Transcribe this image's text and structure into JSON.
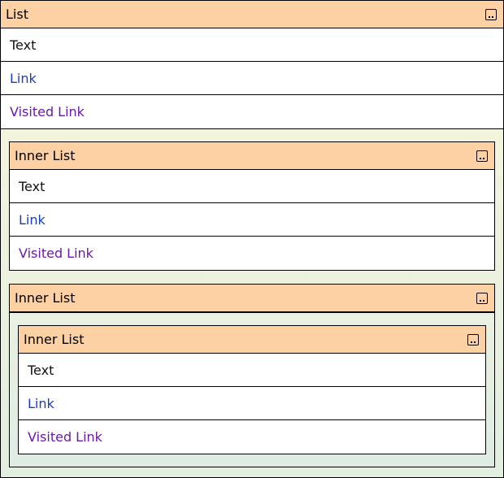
{
  "root": {
    "title": "List",
    "rows": [
      {
        "label": "Text"
      },
      {
        "label": "Link"
      },
      {
        "label": "Visited Link"
      }
    ]
  },
  "inner1": {
    "title": "Inner List",
    "rows": [
      {
        "label": "Text"
      },
      {
        "label": "Link"
      },
      {
        "label": "Visited Link"
      }
    ]
  },
  "inner2": {
    "title": "Inner List"
  },
  "inner3": {
    "title": "Inner List",
    "rows": [
      {
        "label": "Text"
      },
      {
        "label": "Link"
      },
      {
        "label": "Visited Link"
      }
    ]
  },
  "colors": {
    "header_bg": "#fdd1a4",
    "link": "#1a3cc4",
    "visited_link": "#6a1aa6",
    "nest_bg": "#eef2df"
  },
  "icons": {
    "menu": "ellipsis-menu-icon"
  }
}
